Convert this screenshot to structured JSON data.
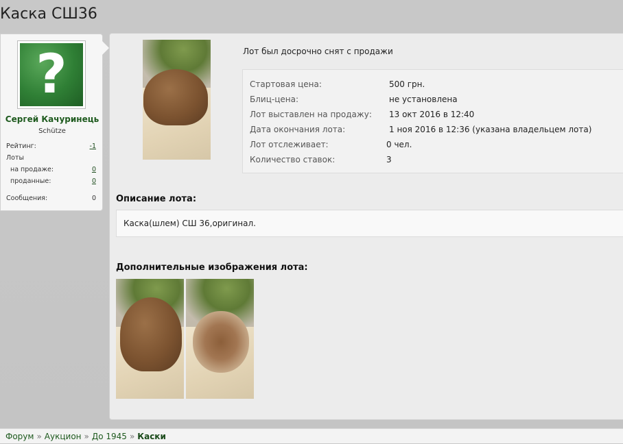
{
  "page": {
    "title": "Каска СШ36"
  },
  "user": {
    "name": "Сергей Качуринець",
    "rank": "Schütze",
    "avatar_icon": "question-mark-icon",
    "avatar_glyph": "?",
    "rating_label": "Рейтинг:",
    "rating_value": "-1",
    "lots_label": "Лоты",
    "on_sale_label": "на продаже:",
    "on_sale_value": "0",
    "sold_label": "проданные:",
    "sold_value": "0",
    "messages_label": "Сообщения:",
    "messages_value": "0"
  },
  "lot": {
    "status": "Лот был досрочно снят с продажи",
    "info": [
      {
        "label": "Стартовая цена:",
        "value": "500 грн."
      },
      {
        "label": "Блиц-цена:",
        "value": "не установлена"
      },
      {
        "label": "Лот выставлен на продажу:",
        "value": "13 окт 2016 в 12:40"
      },
      {
        "label": "Дата окончания лота:",
        "value": "1 ноя 2016 в 12:36 (указана владельцем лота)"
      },
      {
        "label": "Лот отслеживает:",
        "value": "0 чел."
      },
      {
        "label": "Количество ставок:",
        "value": "3"
      }
    ],
    "description_title": "Описание лота:",
    "description": "Каска(шлем) СШ 36,оригинал.",
    "extra_images_title": "Дополнительные изображения лота:"
  },
  "breadcrumb": {
    "items": [
      "Форум",
      "Аукцион",
      "До 1945",
      "Каски"
    ],
    "separator": "»"
  }
}
